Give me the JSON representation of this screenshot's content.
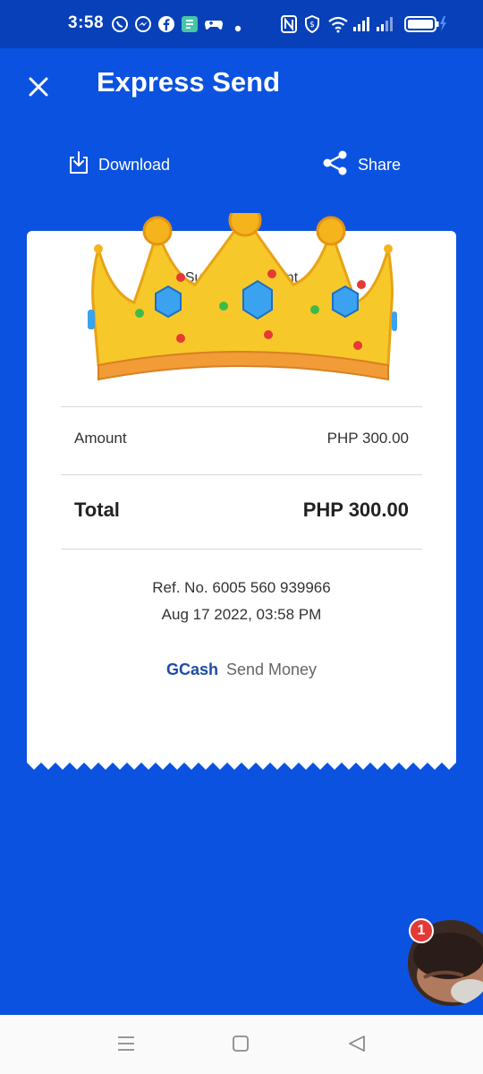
{
  "status_bar": {
    "time": "3:58",
    "left_icons": [
      "viber-icon",
      "messenger-icon",
      "facebook-icon",
      "app-icon",
      "game-controller-icon",
      "dot-icon"
    ],
    "right_icons": [
      "nfc-icon",
      "vpn-shield-icon",
      "wifi-icon",
      "signal-icon",
      "signal-icon",
      "battery-icon"
    ]
  },
  "header": {
    "title": "Express Send",
    "close_icon": "close-icon"
  },
  "actions": {
    "download_label": "Download",
    "share_label": "Share"
  },
  "receipt": {
    "status_text": "Successfully Sent",
    "amount_label": "Amount",
    "amount_value": "PHP 300.00",
    "total_label": "Total",
    "total_value": "PHP 300.00",
    "ref_no": "Ref. No. 6005 560 939966",
    "datetime": "Aug 17 2022, 03:58 PM",
    "brand": "GCash",
    "brand_suffix": "Send Money"
  },
  "chat_head": {
    "badge_count": "1"
  },
  "navigation": {
    "icons": [
      "menu-icon",
      "home-square-icon",
      "back-triangle-icon"
    ]
  },
  "colors": {
    "primary": "#0b52e0",
    "status_bar": "#0740b8",
    "brand_text": "#1d4ba8"
  }
}
